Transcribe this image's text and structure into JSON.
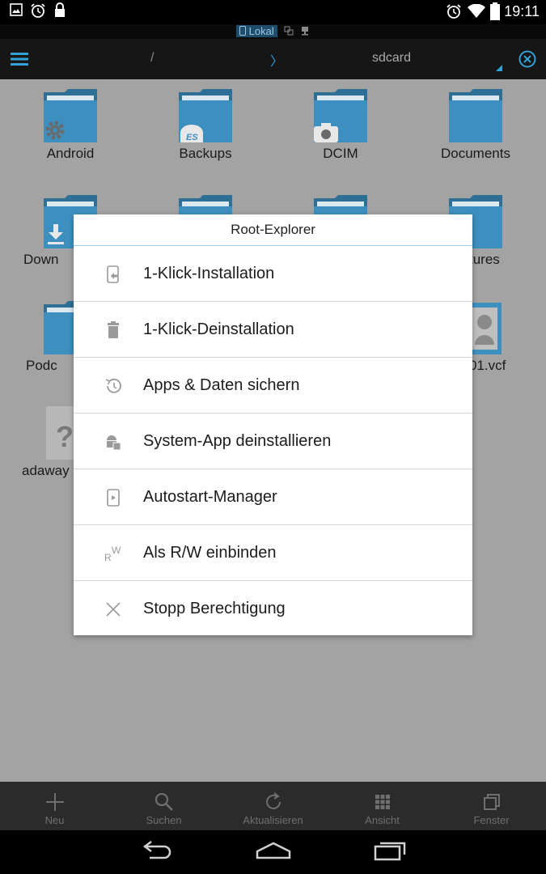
{
  "status_bar": {
    "time": "19:11"
  },
  "location": {
    "tab_label": "Lokal"
  },
  "path_bar": {
    "root": "/",
    "separator": "〉",
    "current": "sdcard"
  },
  "files": [
    {
      "name": "Android",
      "overlay": "gear-icon"
    },
    {
      "name": "Backups",
      "overlay": "es-logo-icon"
    },
    {
      "name": "DCIM",
      "overlay": "camera-icon"
    },
    {
      "name": "Documents",
      "overlay": "none"
    },
    {
      "name": "Down",
      "overlay": "download-icon"
    },
    {
      "name": "tures",
      "overlay": "none"
    },
    {
      "name": "Podc",
      "overlay": "none"
    },
    {
      "name": "01.vcf",
      "overlay": "contact-icon"
    },
    {
      "name": "adaway",
      "overlay": "unknown-file-icon"
    }
  ],
  "dialog": {
    "title": "Root-Explorer",
    "items": [
      {
        "label": "1-Klick-Installation",
        "icon": "install-icon"
      },
      {
        "label": "1-Klick-Deinstallation",
        "icon": "trash-icon"
      },
      {
        "label": "Apps & Daten sichern",
        "icon": "history-icon"
      },
      {
        "label": "System-App deinstallieren",
        "icon": "android-icon"
      },
      {
        "label": "Autostart-Manager",
        "icon": "autostart-icon"
      },
      {
        "label": "Als R/W einbinden",
        "icon": "rw-icon"
      },
      {
        "label": "Stopp Berechtigung",
        "icon": "close-icon"
      }
    ],
    "rw_icon_text": {
      "r": "R",
      "w": "W"
    }
  },
  "toolbar": {
    "new": "Neu",
    "search": "Suchen",
    "refresh": "Aktualisieren",
    "view": "Ansicht",
    "windows": "Fenster"
  },
  "colors": {
    "accent": "#33a0d6",
    "folder": "#3d8fbf",
    "dialog_divider": "#9fcde8"
  }
}
